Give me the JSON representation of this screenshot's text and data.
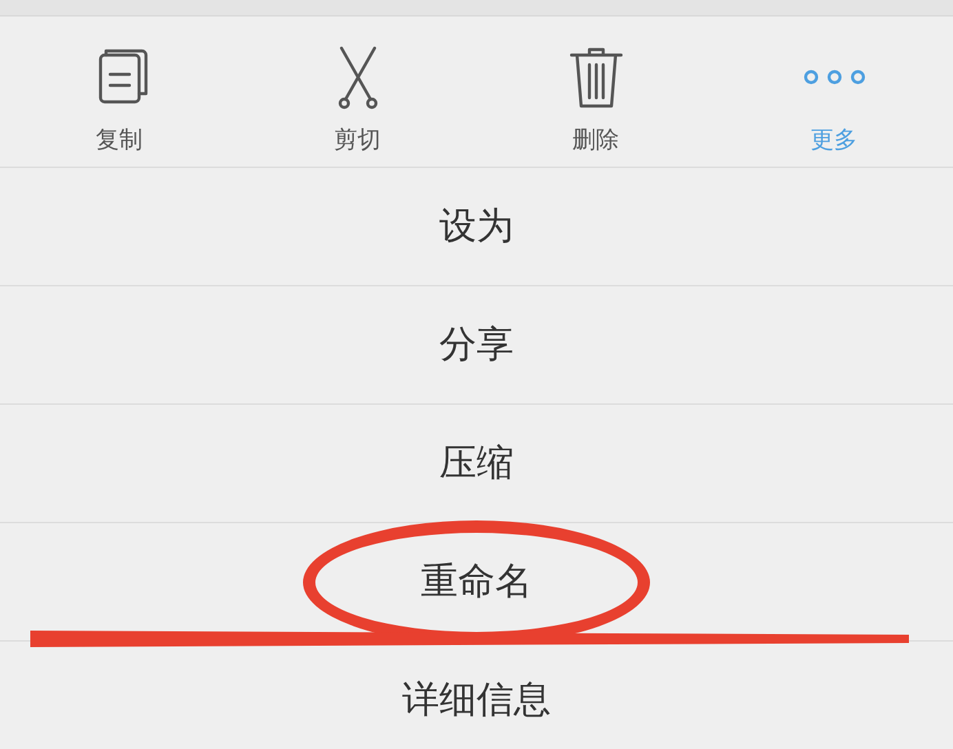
{
  "toolbar": [
    {
      "label": "复制",
      "kind": "copy",
      "selected": false
    },
    {
      "label": "剪切",
      "kind": "cut",
      "selected": false
    },
    {
      "label": "删除",
      "kind": "delete",
      "selected": false
    },
    {
      "label": "更多",
      "kind": "more",
      "selected": true
    }
  ],
  "menu": [
    "设为",
    "分享",
    "压缩",
    "重命名",
    "详细信息"
  ]
}
